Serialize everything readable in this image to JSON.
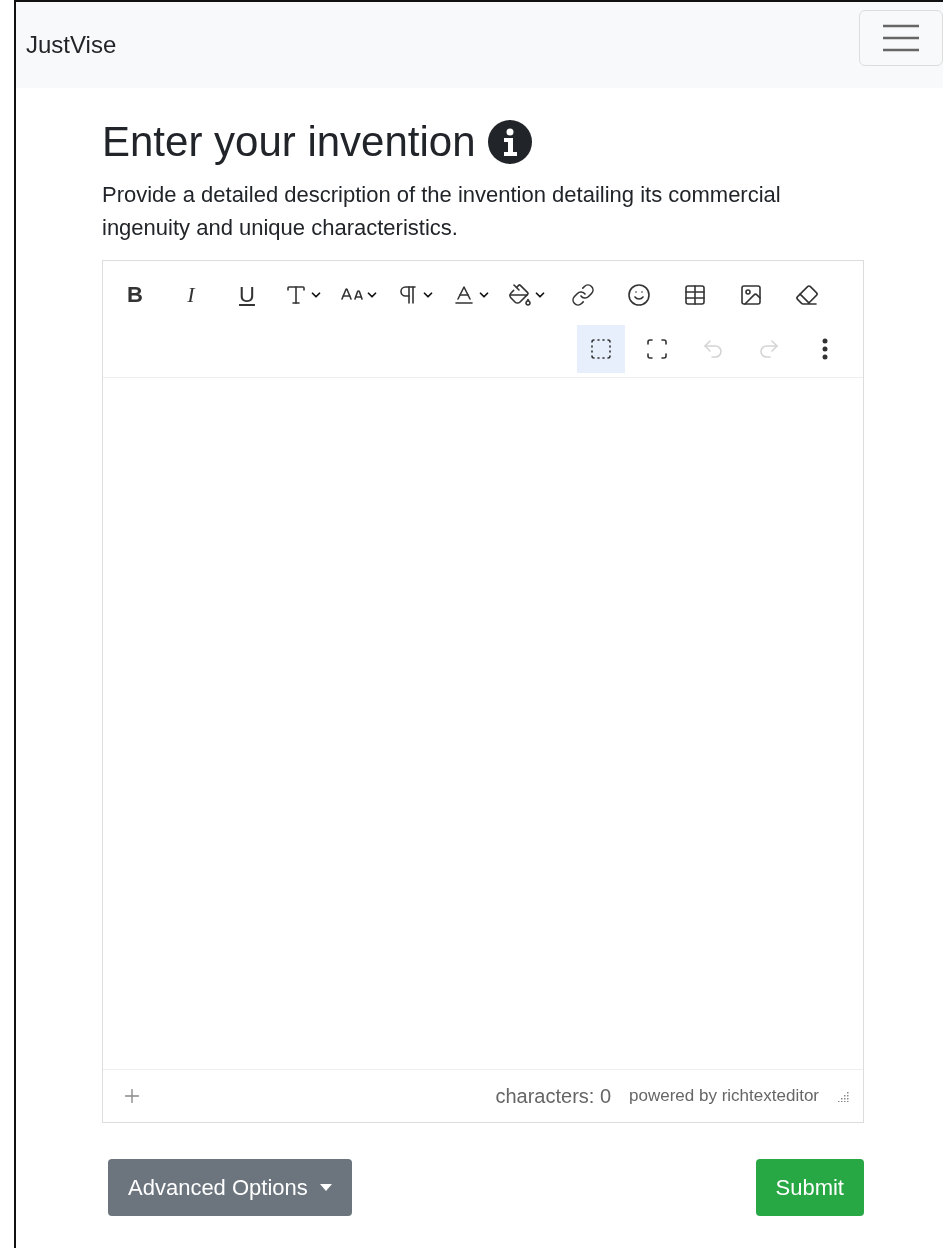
{
  "navbar": {
    "brand": "JustVise"
  },
  "heading": {
    "title": "Enter your invention",
    "description": "Provide a detailed description of the invention detailing its commercial ingenuity and unique characteristics."
  },
  "editor": {
    "tools": [
      {
        "kind": "bold",
        "label": "B",
        "disabled": false,
        "highlighted": false
      },
      {
        "kind": "italic",
        "label": "I",
        "disabled": false,
        "highlighted": false
      },
      {
        "kind": "underline",
        "label": "U",
        "disabled": false,
        "highlighted": false
      },
      {
        "kind": "font-name",
        "disabled": false,
        "highlighted": false
      },
      {
        "kind": "font-size",
        "disabled": false,
        "highlighted": false
      },
      {
        "kind": "paragraph",
        "disabled": false,
        "highlighted": false
      },
      {
        "kind": "font-color",
        "disabled": false,
        "highlighted": false
      },
      {
        "kind": "highlight",
        "disabled": false,
        "highlighted": false
      },
      {
        "kind": "link",
        "disabled": false,
        "highlighted": false
      },
      {
        "kind": "emoji",
        "disabled": false,
        "highlighted": false
      },
      {
        "kind": "table",
        "disabled": false,
        "highlighted": false
      },
      {
        "kind": "image",
        "disabled": false,
        "highlighted": false
      },
      {
        "kind": "eraser",
        "disabled": false,
        "highlighted": false
      },
      {
        "kind": "select-all",
        "disabled": false,
        "highlighted": true
      },
      {
        "kind": "fullscreen",
        "disabled": false,
        "highlighted": false
      },
      {
        "kind": "undo",
        "disabled": true,
        "highlighted": false
      },
      {
        "kind": "redo",
        "disabled": true,
        "highlighted": false
      },
      {
        "kind": "more",
        "disabled": false,
        "highlighted": false
      }
    ],
    "character_count": "characters: 0",
    "powered_by": "powered by richtexteditor"
  },
  "buttons": {
    "advanced": "Advanced Options",
    "submit": "Submit"
  }
}
